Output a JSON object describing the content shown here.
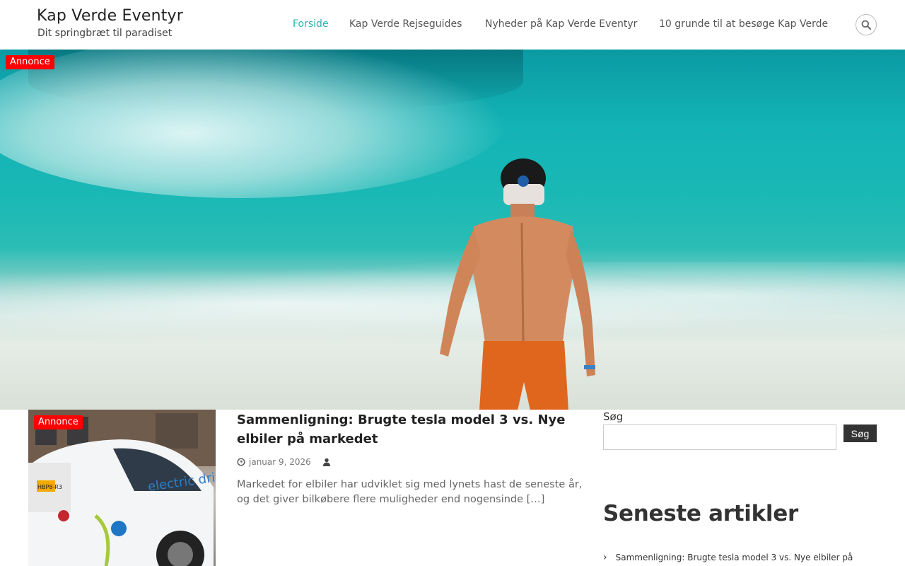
{
  "header": {
    "site_title": "Kap Verde Eventyr",
    "tagline": "Dit springbræt til paradiset"
  },
  "nav": {
    "items": [
      {
        "label": "Forside",
        "active": true
      },
      {
        "label": "Kap Verde Rejseguides"
      },
      {
        "label": "Nyheder på Kap Verde Eventyr"
      },
      {
        "label": "10 grunde til at besøge Kap Verde"
      }
    ],
    "search_icon": "search-icon"
  },
  "hero": {
    "ad_label": "Annonce"
  },
  "post": {
    "ad_label": "Annonce",
    "title": "Sammenligning: Brugte tesla model 3 vs. Nye elbiler på markedet",
    "date": "januar 9, 2026",
    "excerpt": "Markedet for elbiler har udviklet sig med lynets hast de seneste år, og det giver bilkøbere flere muligheder end nogensinde […]",
    "thumb_text": "electric drive",
    "thumb_plate": "HBP8-R3"
  },
  "sidebar": {
    "search_label": "Søg",
    "search_value": "",
    "search_button": "Søg",
    "recent_title": "Seneste artikler",
    "recent_items": [
      "Sammenligning: Brugte tesla model 3 vs. Nye elbiler på"
    ]
  },
  "colors": {
    "accent": "#2ab1b3",
    "ad_badge": "#ff0000"
  }
}
